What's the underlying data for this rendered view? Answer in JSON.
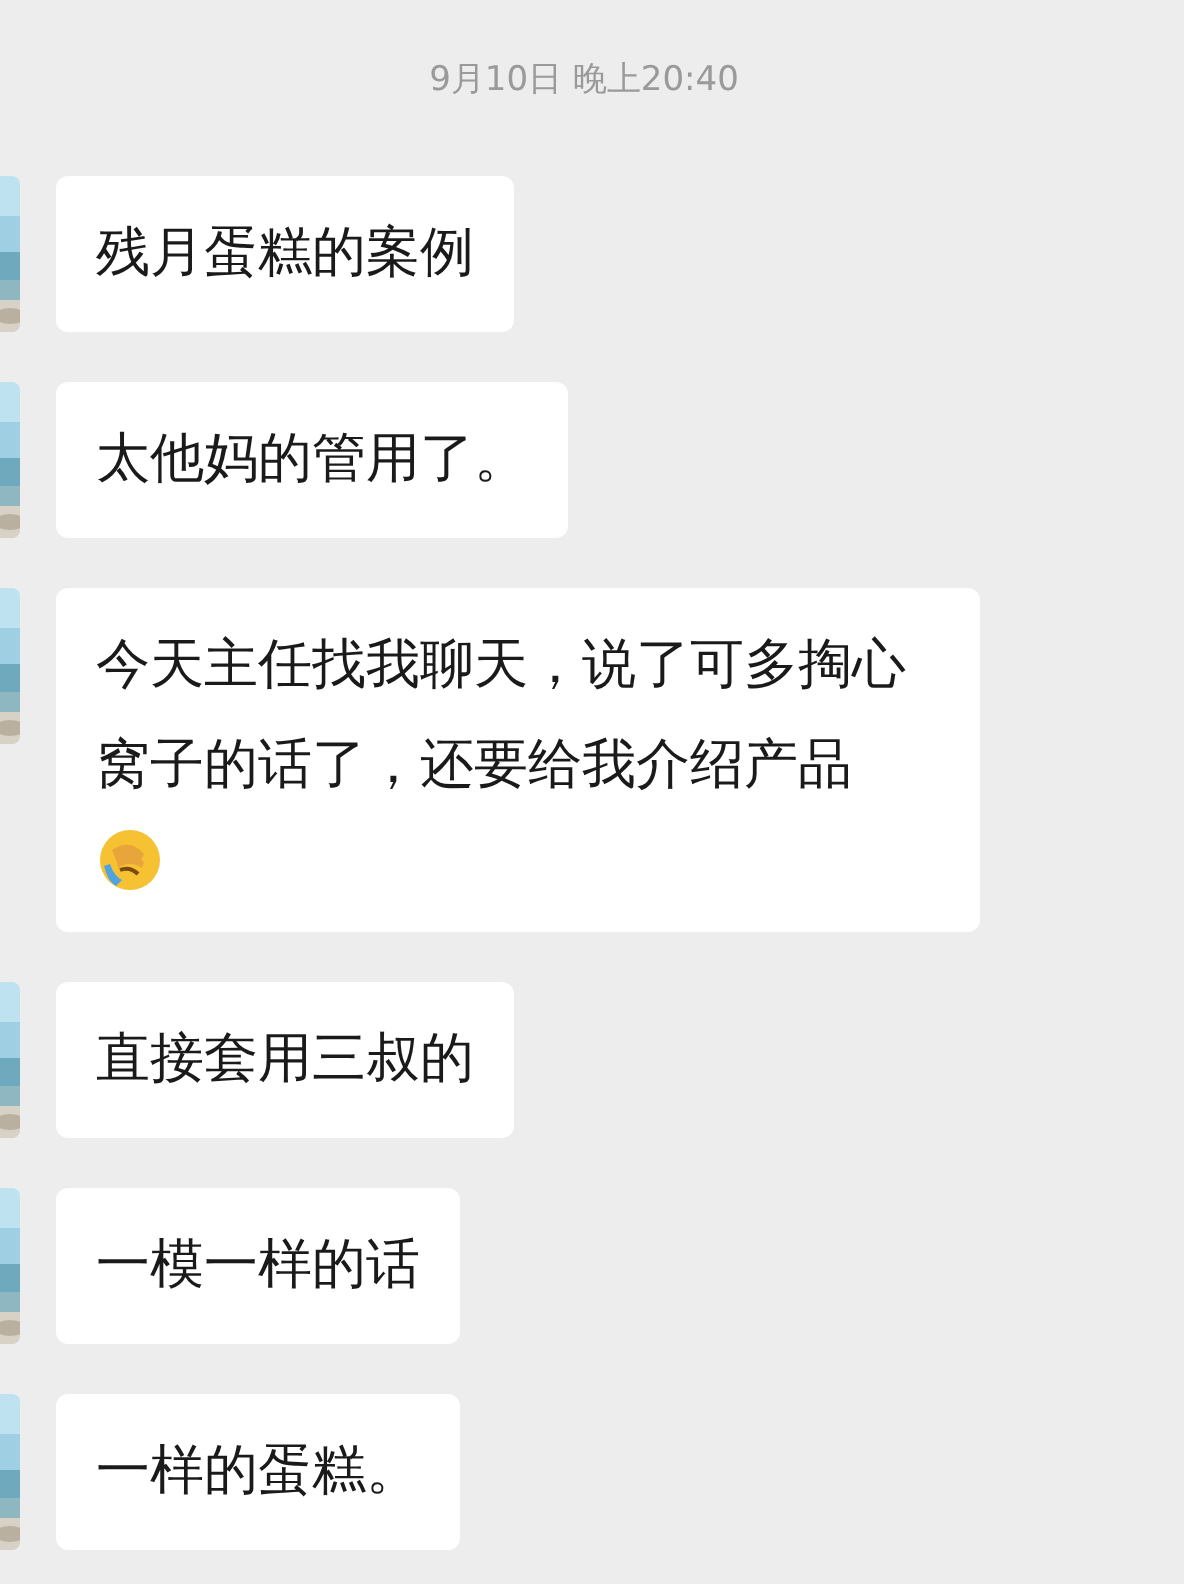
{
  "timestamp": "9月10日 晚上20:40",
  "messages": [
    {
      "text": "残月蛋糕的案例",
      "emoji": false
    },
    {
      "text": "太他妈的管用了。",
      "emoji": false
    },
    {
      "text": "今天主任找我聊天，说了可多掏心窝子的话了，还要给我介绍产品",
      "emoji": true
    },
    {
      "text": "直接套用三叔的",
      "emoji": false
    },
    {
      "text": "一模一样的话",
      "emoji": false
    },
    {
      "text": "一样的蛋糕。",
      "emoji": false
    }
  ]
}
